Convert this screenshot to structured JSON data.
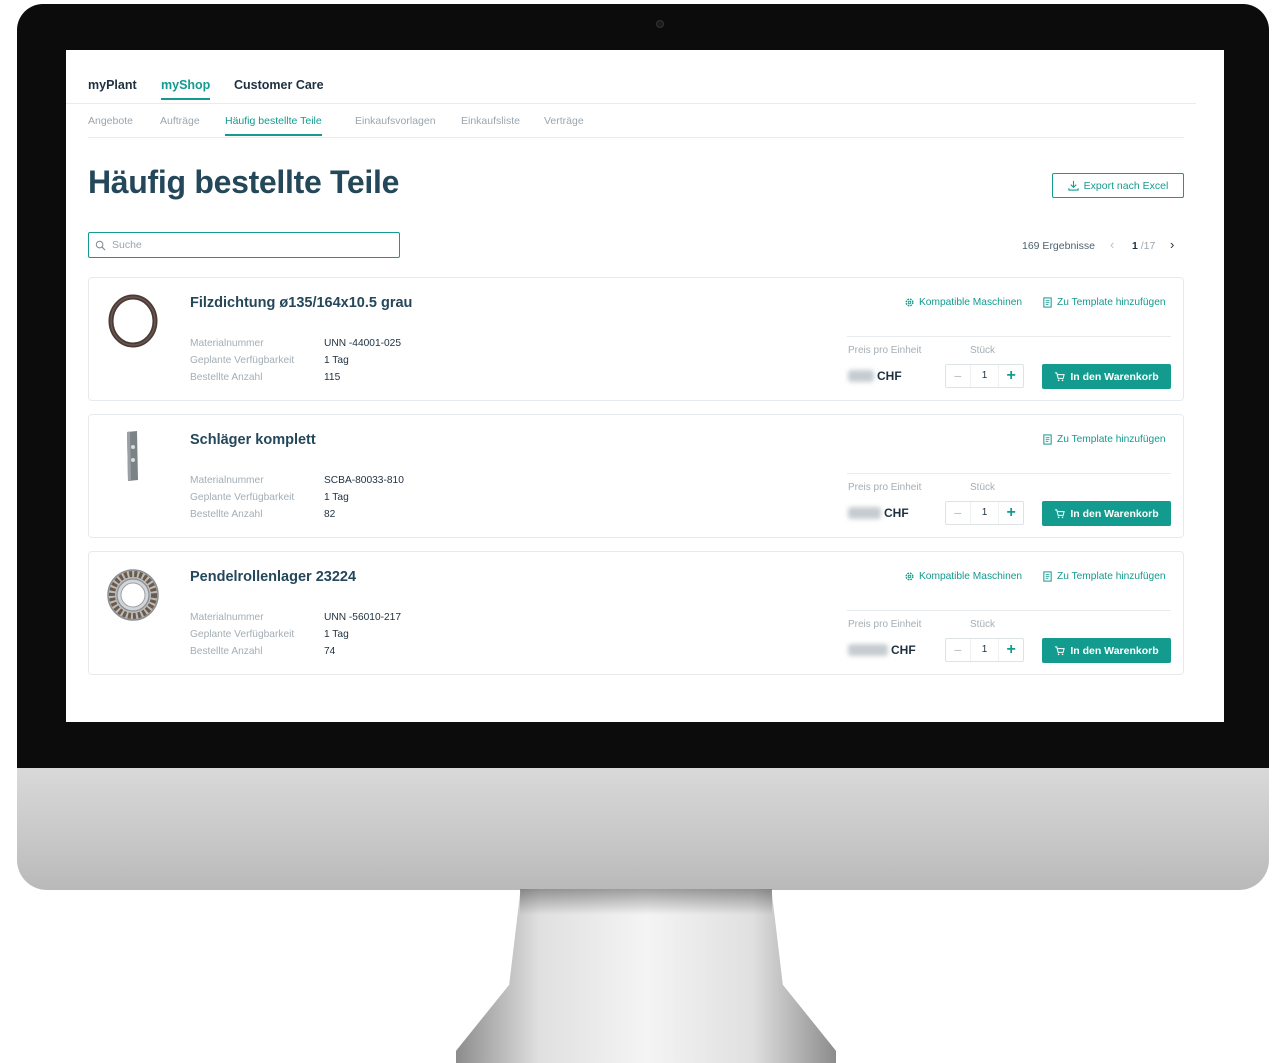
{
  "topnav": {
    "items": [
      "myPlant",
      "myShop",
      "Customer Care"
    ],
    "active_index": 1
  },
  "subnav": {
    "items": [
      "Angebote",
      "Aufträge",
      "Häufig bestellte Teile",
      "Einkaufsvorlagen",
      "Einkaufsliste",
      "Verträge"
    ],
    "active_index": 2
  },
  "page": {
    "title": "Häufig bestellte Teile",
    "export_label": "Export nach Excel"
  },
  "search": {
    "placeholder": "Suche",
    "value": ""
  },
  "pagination": {
    "results": "169 Ergebnisse",
    "page": "1",
    "total": "/17"
  },
  "labels": {
    "material": "Materialnummer",
    "availability": "Geplante Verfügbarkeit",
    "ordered": "Bestellte Anzahl",
    "price_per_unit": "Preis pro Einheit",
    "quantity": "Stück",
    "compatible": "Kompatible Maschinen",
    "template": "Zu Template hinzufügen",
    "add_to_cart": "In den Warenkorb",
    "currency": "CHF"
  },
  "products": [
    {
      "name": "Filzdichtung ø135/164x10.5 grau",
      "material": "UNN -44001-025",
      "availability": "1 Tag",
      "ordered": "115",
      "qty": "1",
      "has_compatible": true,
      "image": "seal-ring"
    },
    {
      "name": "Schläger komplett",
      "material": "SCBA-80033-810",
      "availability": "1 Tag",
      "ordered": "82",
      "qty": "1",
      "has_compatible": false,
      "image": "beater-part"
    },
    {
      "name": "Pendelrollenlager 23224",
      "material": "UNN -56010-217",
      "availability": "1 Tag",
      "ordered": "74",
      "qty": "1",
      "has_compatible": true,
      "image": "roller-bearing"
    }
  ],
  "colors": {
    "accent": "#139b8f",
    "title": "#24475a",
    "text": "#1e3040",
    "muted": "#a3aeb5"
  },
  "icons": [
    "search-icon",
    "download-icon",
    "gear-icon",
    "document-icon",
    "cart-icon",
    "chevron-left-icon",
    "chevron-right-icon"
  ]
}
